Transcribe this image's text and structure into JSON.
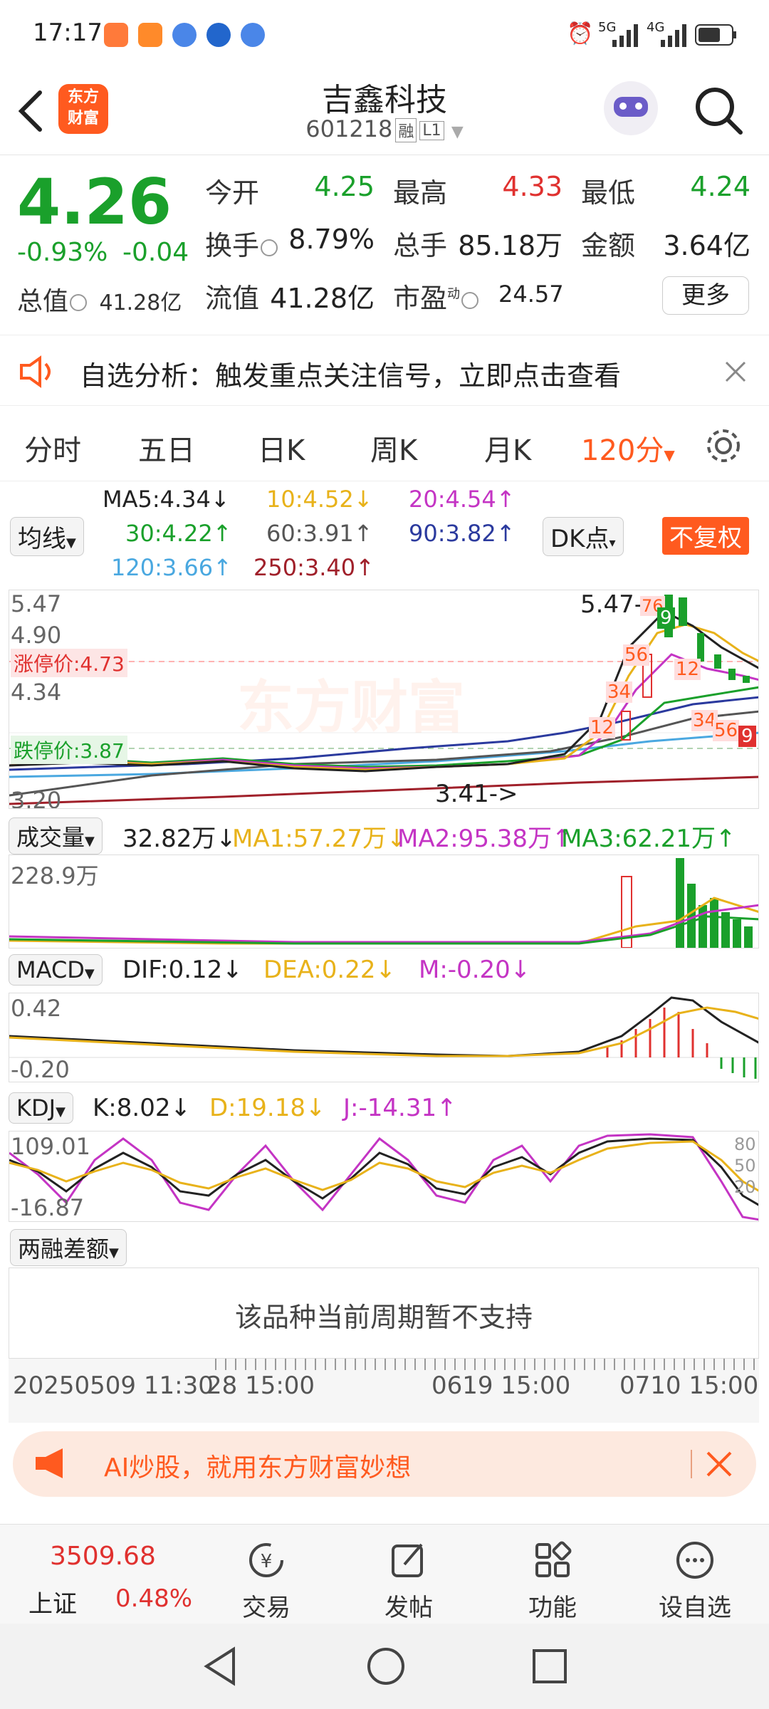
{
  "status_bar": {
    "time": "17:17",
    "net1": "5G",
    "net2": "4G",
    "notif_icons": [
      "app-orange-icon",
      "video-orange-icon",
      "blue-app-icon",
      "blue-circle-icon",
      "blue-app-icon-2"
    ]
  },
  "header": {
    "logo_line1": "东方",
    "logo_line2": "财富",
    "stock_name": "吉鑫科技",
    "stock_code": "601218",
    "tag_margin": "融",
    "tag_level": "L1"
  },
  "quote": {
    "price": "4.26",
    "change_pct": "-0.93%",
    "change_abs": "-0.04",
    "open_label": "今开",
    "open": "4.25",
    "high_label": "最高",
    "high": "4.33",
    "low_label": "最低",
    "low": "4.24",
    "turnover_label": "换手",
    "turnover": "8.79%",
    "volume_label": "总手",
    "volume": "85.18万",
    "amount_label": "金额",
    "amount": "3.64亿",
    "mktcap_label": "总值",
    "mktcap": "41.28亿",
    "float_label": "流值",
    "float_cap": "41.28亿",
    "pe_label": "市盈",
    "pe_sup": "动",
    "pe": "24.57",
    "more": "更多"
  },
  "alert": {
    "text": "自选分析：触发重点关注信号，立即点击查看"
  },
  "tabs": [
    "分时",
    "五日",
    "日K",
    "周K",
    "月K",
    "120分"
  ],
  "ma_legend": {
    "selector": "均线",
    "ma5": "MA5:4.34↓",
    "ma10": "10:4.52↓",
    "ma20": "20:4.54↑",
    "ma30": "30:4.22↑",
    "ma60": "60:3.91↑",
    "ma90": "90:3.82↑",
    "ma120": "120:3.66↑",
    "ma250": "250:3.40↑",
    "dk": "DK点",
    "fq": "不复权"
  },
  "kline": {
    "y_max": "5.47",
    "y_2": "4.90",
    "limit_up": "涨停价:4.73",
    "y_3": "4.34",
    "limit_down": "跌停价:3.87",
    "y_min": "3.20",
    "hi_marker": "5.47->",
    "lo_marker": "3.41->",
    "watermark": "东方财富",
    "badges": [
      "76",
      "9",
      "56",
      "12",
      "34",
      "12",
      "34",
      "56",
      "9"
    ]
  },
  "volume": {
    "selector": "成交量",
    "v": "32.82万↓",
    "ma1": "MA1:57.27万↓",
    "ma2": "MA2:95.38万↑",
    "ma3": "MA3:62.21万↑",
    "y_max": "228.9万"
  },
  "macd": {
    "selector": "MACD",
    "dif": "DIF:0.12↓",
    "dea": "DEA:0.22↓",
    "m": "M:-0.20↓",
    "y_max": "0.42",
    "y_min": "-0.20"
  },
  "kdj": {
    "selector": "KDJ",
    "k": "K:8.02↓",
    "d": "D:19.18↓",
    "j": "J:-14.31↑",
    "y_max": "109.01",
    "y_min": "-16.87",
    "r80": "80",
    "r50": "50",
    "r20": "20"
  },
  "margin": {
    "selector": "两融差额",
    "message": "该品种当前周期暂不支持"
  },
  "time_axis": {
    "t1": "20250509 11:30",
    "t2": "28 15:00",
    "t3": "0619 15:00",
    "t4": "0710 15:00"
  },
  "banner": {
    "text": "AI炒股，就用东方财富妙想"
  },
  "index": {
    "value": "3509.68",
    "name": "上证",
    "pct": "0.48%"
  },
  "bottom_nav": [
    "交易",
    "发帖",
    "功能",
    "设自选"
  ],
  "colors": {
    "up": "#e0312f",
    "down": "#1aa02b",
    "accent": "#ff5a1f",
    "ma5": "#222222",
    "ma10": "#e8b21a",
    "ma20": "#c434c4",
    "ma30": "#1aa02b",
    "ma60": "#555555",
    "ma90": "#2b3a9e",
    "ma120": "#4aa8e0",
    "ma250": "#a0202a"
  }
}
